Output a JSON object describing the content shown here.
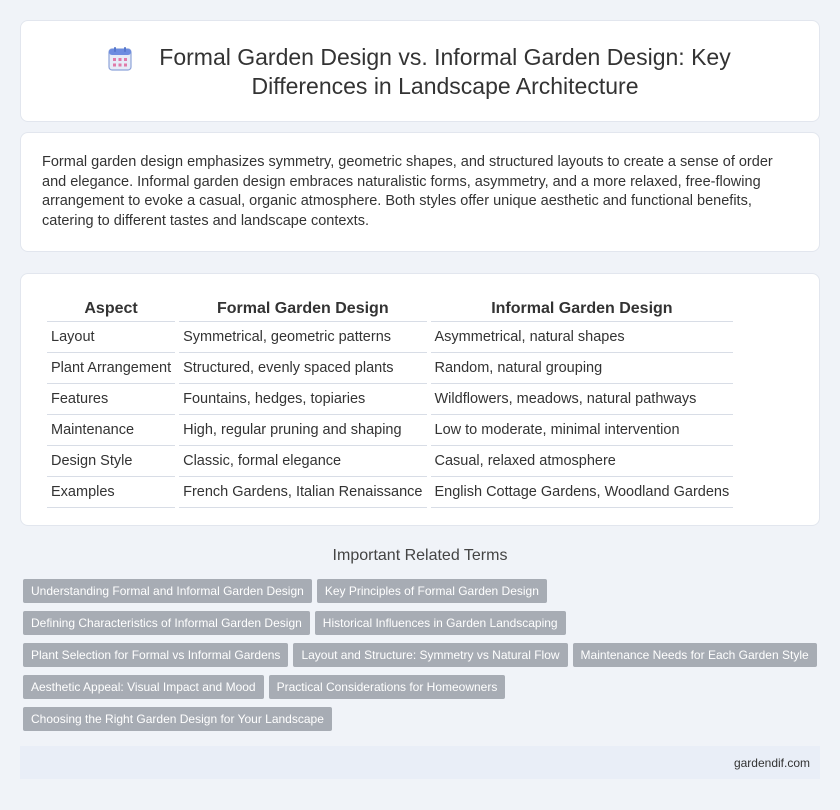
{
  "header": {
    "title": "Formal Garden Design vs. Informal Garden Design: Key Differences in Landscape Architecture",
    "icon": "calendar-icon"
  },
  "intro": "Formal garden design emphasizes symmetry, geometric shapes, and structured layouts to create a sense of order and elegance. Informal garden design embraces naturalistic forms, asymmetry, and a more relaxed, free-flowing arrangement to evoke a casual, organic atmosphere. Both styles offer unique aesthetic and functional benefits, catering to different tastes and landscape contexts.",
  "table": {
    "headers": [
      "Aspect",
      "Formal Garden Design",
      "Informal Garden Design"
    ],
    "rows": [
      [
        "Layout",
        "Symmetrical, geometric patterns",
        "Asymmetrical, natural shapes"
      ],
      [
        "Plant Arrangement",
        "Structured, evenly spaced plants",
        "Random, natural grouping"
      ],
      [
        "Features",
        "Fountains, hedges, topiaries",
        "Wildflowers, meadows, natural pathways"
      ],
      [
        "Maintenance",
        "High, regular pruning and shaping",
        "Low to moderate, minimal intervention"
      ],
      [
        "Design Style",
        "Classic, formal elegance",
        "Casual, relaxed atmosphere"
      ],
      [
        "Examples",
        "French Gardens, Italian Renaissance",
        "English Cottage Gardens, Woodland Gardens"
      ]
    ]
  },
  "related": {
    "heading": "Important Related Terms",
    "rows": [
      [
        "Understanding Formal and Informal Garden Design",
        "Key Principles of Formal Garden Design"
      ],
      [
        "Defining Characteristics of Informal Garden Design",
        "Historical Influences in Garden Landscaping"
      ],
      [
        "Plant Selection for Formal vs Informal Gardens",
        "Layout and Structure: Symmetry vs Natural Flow",
        "Maintenance Needs for Each Garden Style"
      ],
      [
        "Aesthetic Appeal: Visual Impact and Mood",
        "Practical Considerations for Homeowners"
      ],
      [
        "Choosing the Right Garden Design for Your Landscape"
      ]
    ]
  },
  "footer": {
    "site": "gardendif.com"
  },
  "colors": {
    "tag_bg": "#a7acb4",
    "page_bg": "#f0f3f8",
    "footer_bg": "#e9eef7"
  }
}
